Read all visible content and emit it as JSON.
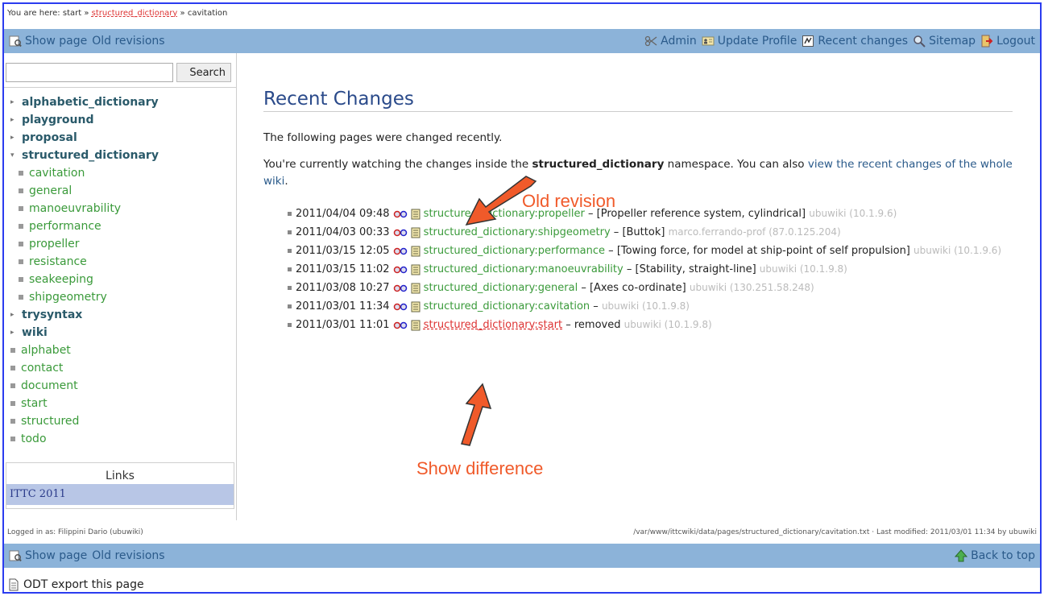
{
  "breadcrumb": {
    "prefix": "You are here:",
    "start": "start",
    "sep1": "»",
    "ns": "structured_dictionary",
    "sep2": "»",
    "current": "cavitation"
  },
  "topbar": {
    "show_page": "Show page",
    "old_revisions": "Old revisions",
    "admin": "Admin",
    "update_profile": "Update Profile",
    "recent_changes": "Recent changes",
    "sitemap": "Sitemap",
    "logout": "Logout"
  },
  "sidebar": {
    "search_button": "Search",
    "tree": [
      {
        "label": "alphabetic_dictionary",
        "type": "ns",
        "marker": "▸"
      },
      {
        "label": "playground",
        "type": "ns",
        "marker": "▸"
      },
      {
        "label": "proposal",
        "type": "ns",
        "marker": "▸"
      },
      {
        "label": "structured_dictionary",
        "type": "ns",
        "marker": "▾"
      },
      {
        "label": "cavitation",
        "type": "sub"
      },
      {
        "label": "general",
        "type": "sub"
      },
      {
        "label": "manoeuvrability",
        "type": "sub"
      },
      {
        "label": "performance",
        "type": "sub"
      },
      {
        "label": "propeller",
        "type": "sub"
      },
      {
        "label": "resistance",
        "type": "sub"
      },
      {
        "label": "seakeeping",
        "type": "sub"
      },
      {
        "label": "shipgeometry",
        "type": "sub"
      },
      {
        "label": "trysyntax",
        "type": "ns",
        "marker": "▸"
      },
      {
        "label": "wiki",
        "type": "ns",
        "marker": "▸"
      },
      {
        "label": "alphabet",
        "type": "pg"
      },
      {
        "label": "contact",
        "type": "pg"
      },
      {
        "label": "document",
        "type": "pg"
      },
      {
        "label": "start",
        "type": "pg"
      },
      {
        "label": "structured",
        "type": "pg"
      },
      {
        "label": "todo",
        "type": "pg"
      }
    ],
    "links_title": "Links",
    "links_item": "ITTC 2011"
  },
  "main": {
    "title": "Recent Changes",
    "intro": "The following pages were changed recently.",
    "watch_prefix": "You're currently watching the changes inside the",
    "watch_ns": "structured_dictionary",
    "watch_mid": "namespace. You can also",
    "watch_link": "view the recent changes of the whole wiki",
    "watch_end": "."
  },
  "changes": [
    {
      "date": "2011/04/04  09:48",
      "page": "structured_dictionary:propeller",
      "dash": "–",
      "summary": "[Propeller reference system, cylindrical]",
      "user": "ubuwiki (10.1.9.6)",
      "red": false
    },
    {
      "date": "2011/04/03 00:33",
      "page": "structured_dictionary:shipgeometry",
      "dash": "–",
      "summary": "[Buttok]",
      "user": "marco.ferrando-prof (87.0.125.204)",
      "red": false
    },
    {
      "date": "2011/03/15  12:05",
      "page": "structured_dictionary:performance",
      "dash": "–",
      "summary": "[Towing force, for model at ship-point of self propulsion]",
      "user": "ubuwiki (10.1.9.6)",
      "red": false
    },
    {
      "date": "2011/03/15 11:02",
      "page": "structured_dictionary:manoeuvrability",
      "dash": "–",
      "summary": "[Stability, straight-line]",
      "user": "ubuwiki (10.1.9.8)",
      "red": false
    },
    {
      "date": "2011/03/08 10:27",
      "page": "structured_dictionary:general",
      "dash": "–",
      "summary": "[Axes co-ordinate]",
      "user": "ubuwiki (130.251.58.248)",
      "red": false
    },
    {
      "date": "2011/03/01 11:34",
      "page": "structured_dictionary:cavitation",
      "dash": "–",
      "summary": "",
      "user": "ubuwiki (10.1.9.8)",
      "red": false
    },
    {
      "date": "2011/03/01 11:01",
      "page": "structured_dictionary:start",
      "dash": "–",
      "summary": "removed",
      "user": "ubuwiki (10.1.9.8)",
      "red": true
    }
  ],
  "annotations": {
    "old_revision": "Old revision",
    "show_difference": "Show difference"
  },
  "footer": {
    "logged_in": "Logged in as: Filippini Dario (ubuwiki)",
    "path": "/var/www/ittcwiki/data/pages/structured_dictionary/cavitation.txt · Last modified: 2011/03/01 11:34 by ubuwiki"
  },
  "bottombar": {
    "show_page": "Show page",
    "old_revisions": "Old revisions",
    "back_to_top": "Back to top"
  },
  "export": {
    "label": "ODT export this page"
  },
  "colors": {
    "accent_bar": "#8cb3d9",
    "link_green": "#3a9a3a",
    "broken_red": "#d33",
    "annot_orange": "#f05a2a"
  }
}
